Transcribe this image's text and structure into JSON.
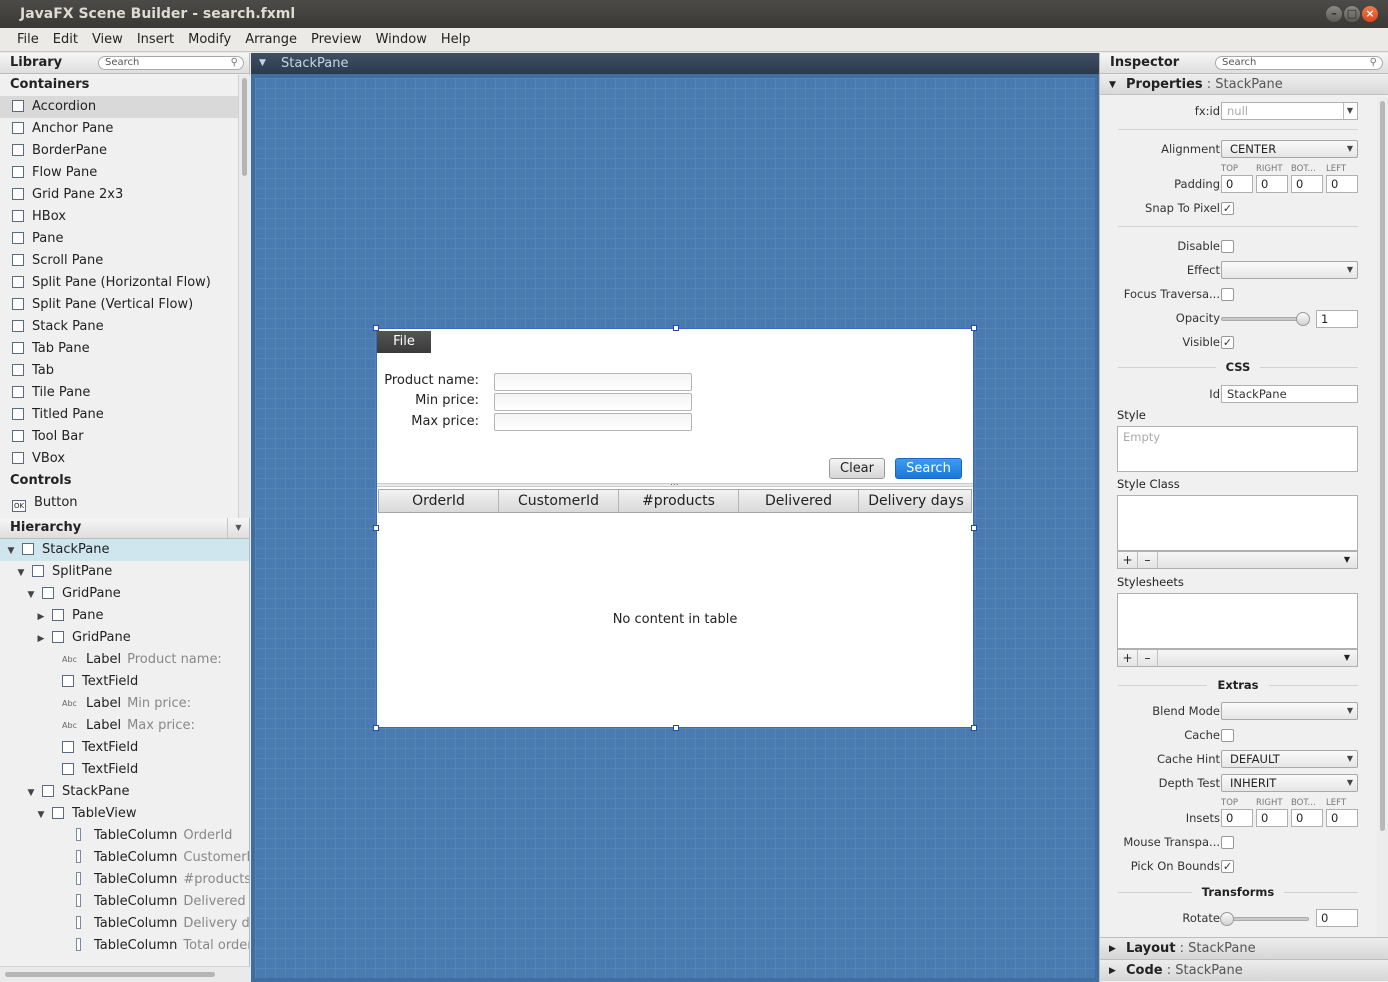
{
  "window": {
    "title": "JavaFX Scene Builder - search.fxml"
  },
  "menu": [
    "File",
    "Edit",
    "View",
    "Insert",
    "Modify",
    "Arrange",
    "Preview",
    "Window",
    "Help"
  ],
  "library": {
    "title": "Library",
    "search_placeholder": "Search",
    "sections": {
      "containers": "Containers",
      "controls": "Controls"
    },
    "items": [
      "Accordion",
      "Anchor Pane",
      "BorderPane",
      "Flow Pane",
      "Grid Pane 2x3",
      "HBox",
      "Pane",
      "Scroll Pane",
      "Split Pane (Horizontal Flow)",
      "Split Pane (Vertical Flow)",
      "Stack Pane",
      "Tab Pane",
      "Tab",
      "Tile Pane",
      "Titled Pane",
      "Tool Bar",
      "VBox"
    ],
    "controls": [
      "Button"
    ]
  },
  "hierarchy": {
    "title": "Hierarchy",
    "nodes": [
      {
        "label": "StackPane",
        "hint": ""
      },
      {
        "label": "SplitPane",
        "hint": ""
      },
      {
        "label": "GridPane",
        "hint": ""
      },
      {
        "label": "Pane",
        "hint": ""
      },
      {
        "label": "GridPane",
        "hint": ""
      },
      {
        "label": "Label",
        "hint": "Product name:"
      },
      {
        "label": "TextField",
        "hint": ""
      },
      {
        "label": "Label",
        "hint": "Min price:"
      },
      {
        "label": "Label",
        "hint": "Max price:"
      },
      {
        "label": "TextField",
        "hint": ""
      },
      {
        "label": "TextField",
        "hint": ""
      },
      {
        "label": "StackPane",
        "hint": ""
      },
      {
        "label": "TableView",
        "hint": ""
      },
      {
        "label": "TableColumn",
        "hint": "OrderId"
      },
      {
        "label": "TableColumn",
        "hint": "CustomerId"
      },
      {
        "label": "TableColumn",
        "hint": "#products"
      },
      {
        "label": "TableColumn",
        "hint": "Delivered"
      },
      {
        "label": "TableColumn",
        "hint": "Delivery days"
      },
      {
        "label": "TableColumn",
        "hint": "Total orders"
      }
    ]
  },
  "canvas": {
    "path": "StackPane",
    "file_menu": "File",
    "labels": {
      "product": "Product name:",
      "min": "Min price:",
      "max": "Max price:"
    },
    "buttons": {
      "clear": "Clear",
      "search": "Search"
    },
    "columns": [
      "OrderId",
      "CustomerId",
      "#products",
      "Delivered",
      "Delivery days"
    ],
    "empty_text": "No content in table",
    "divider_grip": "..."
  },
  "inspector": {
    "title": "Inspector",
    "search_placeholder": "Search",
    "properties_title": "Properties",
    "properties_target": ": StackPane",
    "fxid_label": "fx:id",
    "fxid_value": "null",
    "alignment_label": "Alignment",
    "alignment_value": "CENTER",
    "padding_label": "Padding",
    "side_labels": {
      "top": "TOP",
      "right": "RIGHT",
      "bottom": "BOT...",
      "left": "LEFT"
    },
    "padding_values": [
      "0",
      "0",
      "0",
      "0"
    ],
    "snap_label": "Snap To Pixel",
    "disable_label": "Disable",
    "effect_label": "Effect",
    "focus_label": "Focus Traversa...",
    "opacity_label": "Opacity",
    "opacity_value": "1",
    "visible_label": "Visible",
    "css_header": "CSS",
    "id_label": "Id",
    "id_value": "StackPane",
    "style_label": "Style",
    "style_placeholder": "Empty",
    "style_class_label": "Style Class",
    "stylesheets_label": "Stylesheets",
    "plus": "+",
    "minus": "–",
    "extras_header": "Extras",
    "blend_label": "Blend Mode",
    "cache_label": "Cache",
    "cache_hint_label": "Cache Hint",
    "cache_hint_value": "DEFAULT",
    "depth_label": "Depth Test",
    "depth_value": "INHERIT",
    "insets_label": "Insets",
    "insets_values": [
      "0",
      "0",
      "0",
      "0"
    ],
    "mouse_label": "Mouse Transpa...",
    "pick_label": "Pick On Bounds",
    "transforms_header": "Transforms",
    "rotate_label": "Rotate",
    "rotate_value": "0",
    "layout_title": "Layout",
    "layout_target": ": StackPane",
    "code_title": "Code",
    "code_target": ": StackPane"
  }
}
